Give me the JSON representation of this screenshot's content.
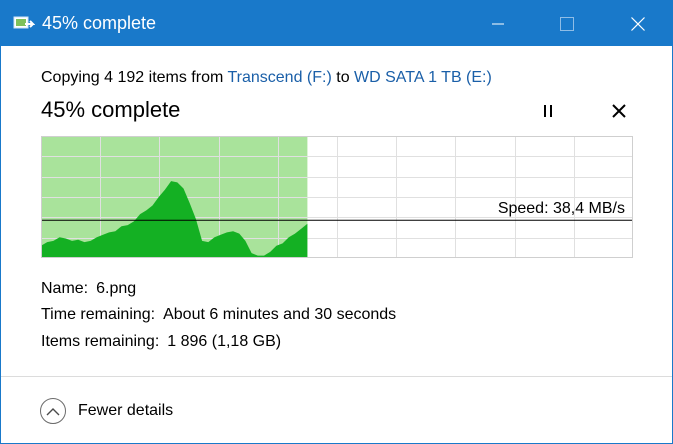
{
  "window": {
    "title": "45% complete",
    "controls": {
      "minimize": "minimize",
      "maximize": "maximize",
      "close": "close"
    }
  },
  "copy": {
    "prefix": "Copying 4 192 items from ",
    "source": "Transcend (F:)",
    "middle": " to ",
    "destination": "WD SATA 1 TB (E:)",
    "status": "45% complete",
    "progress_percent": 45
  },
  "graph": {
    "speed_label": "Speed: 38,4 MB/s",
    "average_level": 0.31,
    "profile": [
      0.1,
      0.13,
      0.14,
      0.17,
      0.16,
      0.14,
      0.15,
      0.13,
      0.14,
      0.17,
      0.19,
      0.21,
      0.22,
      0.26,
      0.27,
      0.3,
      0.36,
      0.39,
      0.43,
      0.5,
      0.56,
      0.63,
      0.62,
      0.57,
      0.45,
      0.32,
      0.14,
      0.13,
      0.17,
      0.19,
      0.21,
      0.22,
      0.2,
      0.14,
      0.04,
      0.02,
      0.02,
      0.05,
      0.1,
      0.12,
      0.17,
      0.2,
      0.24,
      0.28
    ],
    "colors": {
      "fill_done": "#a9e39b",
      "area": "#14b023",
      "grid": "#e0e0e0",
      "border": "#cfcfcf",
      "speed_line": "#000000"
    }
  },
  "details": {
    "name_label": "Name:",
    "name_value": "6.png",
    "time_label": "Time remaining:",
    "time_value": "About 6 minutes and 30 seconds",
    "items_label": "Items remaining:",
    "items_value": "1 896 (1,18 GB)"
  },
  "footer": {
    "toggle_label": "Fewer details",
    "toggle_icon": "chevron-up-icon"
  },
  "theme": {
    "titlebar": "#1979ca",
    "link": "#1a5fa8"
  }
}
